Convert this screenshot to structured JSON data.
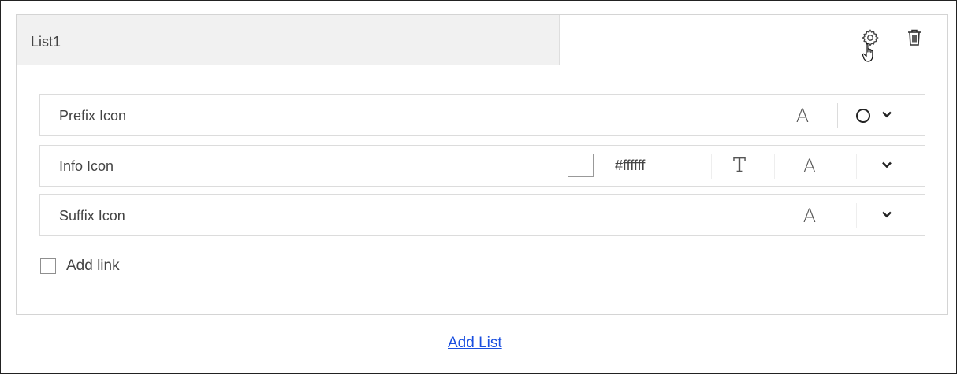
{
  "list": {
    "title": "List1",
    "settings_icon": "gear-icon",
    "delete_icon": "trash-icon"
  },
  "rows": [
    {
      "label": "Prefix Icon",
      "font_icon": "A",
      "selected_icon": "circle-icon"
    },
    {
      "label": "Info Icon",
      "color": "#ffffff",
      "color_text": "#ffffff",
      "text_icon": "T",
      "font_icon": "A"
    },
    {
      "label": "Suffix Icon",
      "font_icon": "A"
    }
  ],
  "add_link": {
    "label": "Add link",
    "checked": false
  },
  "add_list": {
    "label": "Add List"
  },
  "colors": {
    "link": "#1a4fe0",
    "panel_header_bg": "#f1f1f1",
    "border": "#d4d4d4"
  }
}
